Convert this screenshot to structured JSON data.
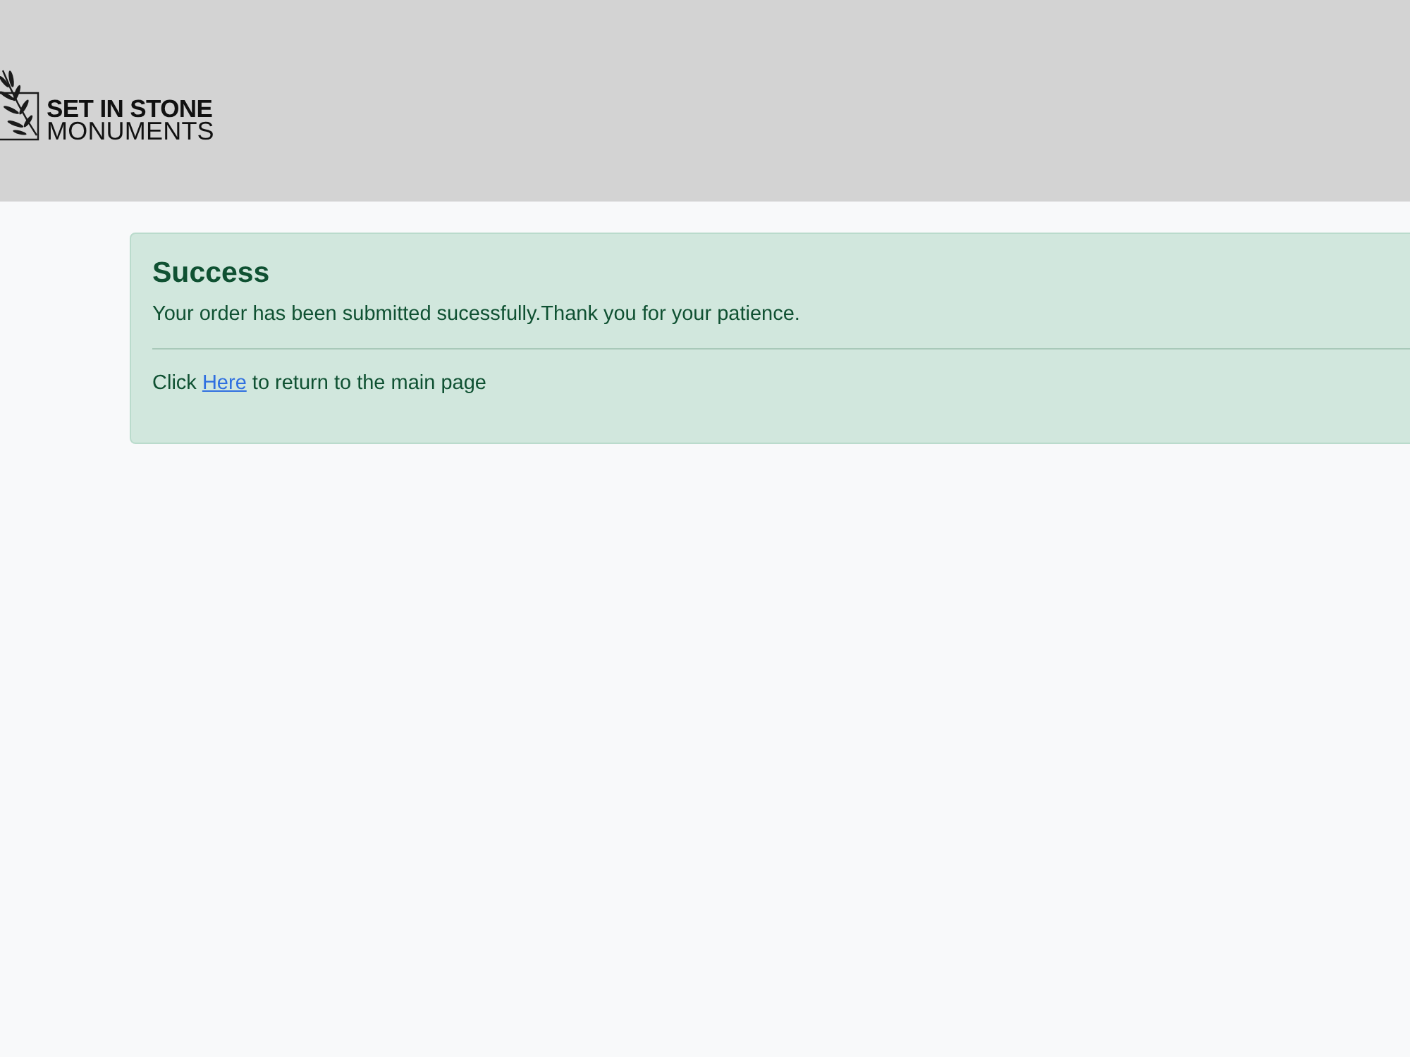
{
  "header": {
    "logo": {
      "line_1": "SET IN STONE",
      "line_2": "MONUMENTS"
    }
  },
  "alert": {
    "kind": "success",
    "heading": "Success",
    "message": "Your order has been submitted sucessfully.Thank you for your patience.",
    "link_prefix": "Click",
    "link": "Here",
    "link_suffix": "to return to the main page"
  }
}
